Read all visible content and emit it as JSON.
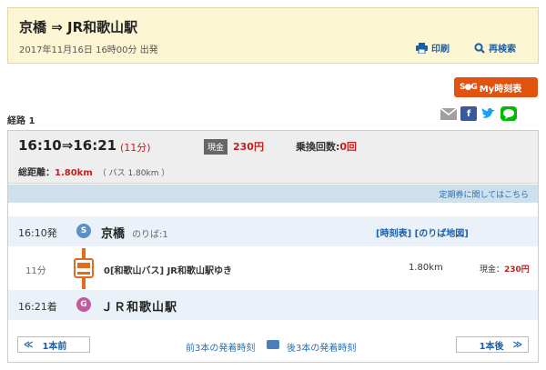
{
  "header": {
    "title": "京橋 ⇒ JR和歌山駅",
    "depart": "2017年11月16日 16時00分 出発",
    "print_label": "印刷",
    "research_label": "再検索"
  },
  "my_timetable": {
    "logo": "S●G",
    "label": "My時刻表"
  },
  "route": {
    "label": "経路 1"
  },
  "share": {
    "icons": [
      "mail-icon",
      "facebook-icon",
      "twitter-icon",
      "line-icon"
    ]
  },
  "summary": {
    "time": "16:10⇒16:21",
    "duration": "(11分)",
    "fare_tag": "現金",
    "fare": "230円",
    "transfer_label": "乗換回数:",
    "transfer_count": "0回",
    "distance_label": "総距離：",
    "distance": "1.80km",
    "bus_distance": "（ バス 1.80km ）"
  },
  "pass_link": "定期券に関してはこちら",
  "stops": {
    "from": {
      "time": "16:10発",
      "icon_letter": "S",
      "name": "京橋",
      "platform": "のりば:1",
      "timetable_link": "[時刻表]",
      "map_link": "[のりば地図]"
    },
    "to": {
      "time": "16:21着",
      "icon_letter": "G",
      "name": "ＪＲ和歌山駅"
    }
  },
  "segment": {
    "duration": "11分",
    "line": "0[和歌山バス] JR和歌山駅ゆき",
    "distance": "1.80km",
    "fare_label": "現金：",
    "fare": "230円"
  },
  "pager": {
    "prev_symbol": "≪",
    "prev_label": "1本前",
    "prev3": "前3本の発着時刻",
    "next3": "後3本の発着時刻",
    "next_label": "1本後",
    "next_symbol": "≫"
  },
  "colors": {
    "accent_orange": "#e2530f",
    "bus_line": "#e36b1e",
    "link_blue": "#1b5fa8",
    "fare_red": "#c02020",
    "start_icon": "#5b8fc7",
    "goal_icon": "#c05aa0"
  }
}
